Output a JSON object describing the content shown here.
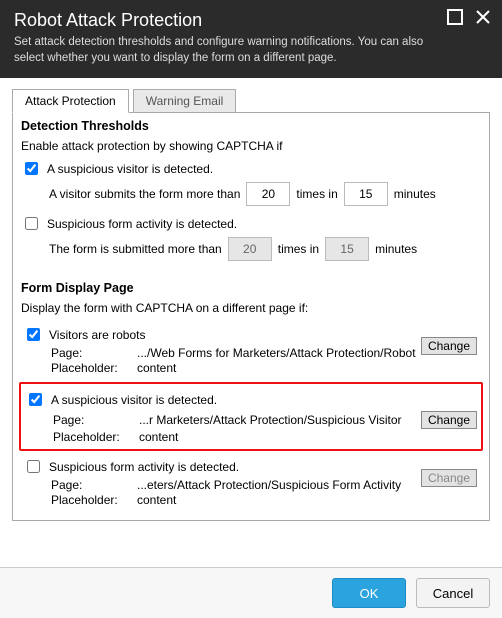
{
  "header": {
    "title": "Robot Attack Protection",
    "subtitle": "Set attack detection thresholds and configure warning notifications. You can also select whether you want to display the form on a different page."
  },
  "tabs": {
    "attack": "Attack Protection",
    "warning": "Warning Email"
  },
  "detection": {
    "heading": "Detection Thresholds",
    "lead": "Enable attack protection by showing CAPTCHA if",
    "suspicious_visitor_label": "A suspicious visitor is detected.",
    "visitor_submits_prefix": "A visitor submits the form more than",
    "times_in": "times in",
    "minutes": "minutes",
    "visitor_times": "20",
    "visitor_minutes": "15",
    "suspicious_activity_label": "Suspicious form activity is detected.",
    "form_submitted_prefix": "The form is submitted more than",
    "activity_times": "20",
    "activity_minutes": "15"
  },
  "fdp": {
    "heading": "Form Display Page",
    "lead": "Display the form with CAPTCHA on a different page if:",
    "page_label": "Page:",
    "placeholder_label": "Placeholder:",
    "change": "Change",
    "robots": {
      "label": "Visitors are robots",
      "page": ".../Web Forms for Marketers/Attack Protection/Robot",
      "placeholder": "content"
    },
    "suspicious": {
      "label": "A suspicious visitor is detected.",
      "page": "...r Marketers/Attack Protection/Suspicious Visitor",
      "placeholder": "content"
    },
    "activity": {
      "label": "Suspicious form activity is detected.",
      "page": "...eters/Attack Protection/Suspicious Form Activity",
      "placeholder": "content"
    }
  },
  "footer": {
    "ok": "OK",
    "cancel": "Cancel"
  }
}
